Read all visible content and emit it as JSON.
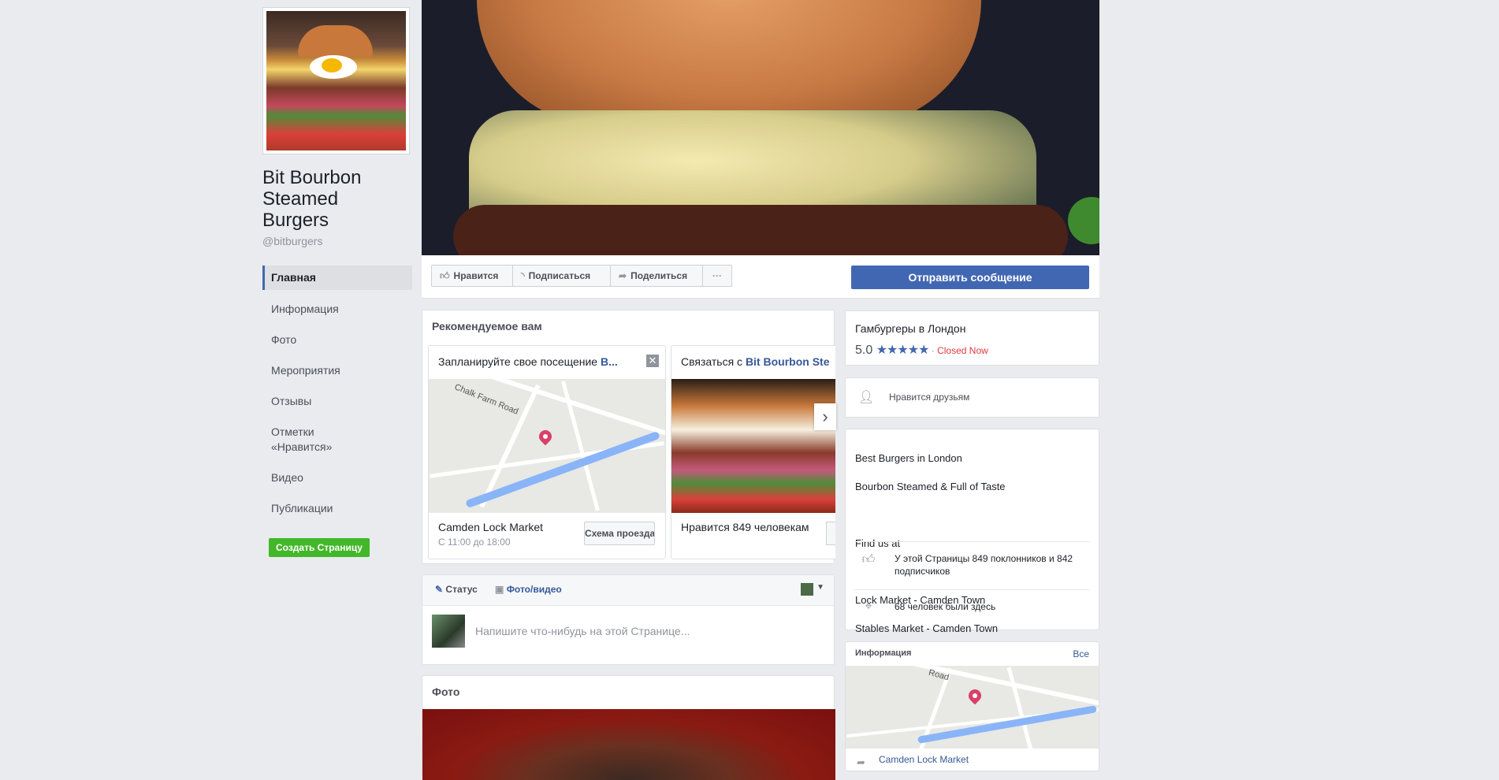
{
  "page": {
    "name": "Bit Bourbon Steamed Burgers",
    "handle": "@bitburgers"
  },
  "nav": {
    "items": [
      "Главная",
      "Информация",
      "Фото",
      "Мероприятия",
      "Отзывы",
      "Отметки «Нравится»",
      "Видео",
      "Публикации"
    ],
    "create_page": "Создать Страницу"
  },
  "actions": {
    "like": "Нравится",
    "follow": "Подписаться",
    "share": "Поделиться",
    "more": "···",
    "message": "Отправить сообщение"
  },
  "recommended": {
    "title": "Рекомендуемое вам",
    "card1_title_prefix": "Запланируйте свое посещение ",
    "card1_title_bold": "B...",
    "card1_place": "Camden Lock Market",
    "card1_hours": "С 11:00 до 18:00",
    "card1_button": "Схема проезда",
    "card2_title_prefix": "Связаться с ",
    "card2_title_bold": "Bit Bourbon Ste",
    "card2_likes": "Нравится 849 человекам",
    "map_street": "Chalk Farm Road"
  },
  "composer": {
    "status": "Статус",
    "photo_video": "Фото/видео",
    "placeholder": "Напишите что-нибудь на этой Странице..."
  },
  "photos": {
    "title": "Фото"
  },
  "about": {
    "category": "Гамбургеры в Лондон",
    "rating": "5.0",
    "stars": "★★★★★",
    "status_sep": " · ",
    "status": "Closed Now",
    "friends_like": "Нравится друзьям",
    "desc_lines": [
      "Best Burgers in London",
      "Bourbon Steamed & Full of Taste",
      "",
      "Find us at",
      "",
      "Lock Market - Camden Town",
      "Stables Market - Camden Town"
    ],
    "fans": "У этой Страницы 849 поклонников и 842 подписчиков",
    "checkins": "68 человек были здесь"
  },
  "info": {
    "title": "Информация",
    "all": "Все",
    "place": "Camden Lock Market",
    "map_street": "Road"
  },
  "colors": {
    "brand_blue": "#4267b2",
    "green": "#42b72a",
    "closed_red": "#e0393e"
  }
}
